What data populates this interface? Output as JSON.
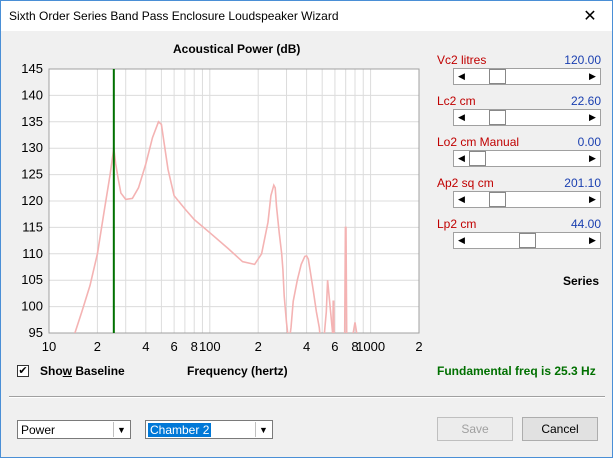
{
  "window": {
    "title": "Sixth Order Series Band Pass Enclosure Loudspeaker Wizard",
    "close_glyph": "✕"
  },
  "chart_title": "Acoustical Power (dB)",
  "chart_data": {
    "type": "line",
    "title": "Acoustical Power (dB)",
    "xlabel": "Frequency (hertz)",
    "ylabel": "",
    "x_scale": "log",
    "xlim": [
      10,
      2000
    ],
    "ylim": [
      95,
      145
    ],
    "yticks": [
      95,
      100,
      105,
      110,
      115,
      120,
      125,
      130,
      135,
      140,
      145
    ],
    "ytick_labels": [
      "95",
      "100",
      "105",
      "110",
      "115",
      "120",
      "125",
      "130",
      "135",
      "140",
      "145"
    ],
    "xticks": [
      10,
      20,
      40,
      60,
      80,
      100,
      200,
      400,
      600,
      800,
      1000,
      2000
    ],
    "xtick_labels": [
      "10",
      "2",
      "4",
      "6",
      "8",
      "100",
      "2",
      "4",
      "6",
      "8",
      "1000",
      "2"
    ],
    "grid": true,
    "marker_line": {
      "x": 25.3,
      "color": "#007000"
    },
    "series": [
      {
        "color": "#f4b3b3",
        "x": [
          14.5,
          16,
          18,
          20,
          22,
          24,
          25.3,
          26,
          27,
          28,
          30,
          33,
          36,
          40,
          44,
          48,
          50,
          52,
          55,
          60,
          70,
          80,
          100,
          130,
          160,
          190,
          210,
          230,
          240,
          250,
          255,
          260,
          270,
          280,
          285,
          290,
          300,
          310,
          320,
          330,
          350,
          370,
          390,
          400,
          410,
          420,
          440,
          460,
          480,
          490,
          500,
          510,
          520,
          530,
          540,
          560,
          580,
          600
        ],
        "values": [
          95,
          99,
          104,
          110,
          118,
          125,
          130,
          127,
          124,
          121.5,
          120.3,
          120.5,
          122.5,
          127,
          132,
          135,
          134.5,
          131,
          126,
          121,
          118.5,
          116.5,
          114,
          111,
          108.5,
          108,
          110,
          116,
          121,
          123,
          122.5,
          119,
          114,
          110,
          107,
          102,
          97,
          93,
          96,
          101,
          105,
          108,
          109.5,
          109.6,
          109,
          107,
          103,
          99,
          96,
          93,
          91,
          93,
          96,
          99,
          105,
          100,
          95,
          91
        ]
      },
      {
        "color": "#f4b3b3",
        "x": [
          580,
          585,
          590,
          595
        ],
        "values": [
          91,
          101,
          101,
          91
        ]
      },
      {
        "color": "#f4b3b3",
        "x": [
          690,
          697,
          700,
          703,
          710
        ],
        "values": [
          95,
          115,
          115,
          115,
          95
        ]
      },
      {
        "color": "#f4b3b3",
        "x": [
          780,
          800,
          820
        ],
        "values": [
          95,
          97,
          95
        ]
      }
    ]
  },
  "sliders": [
    {
      "label": "Vc2  litres",
      "value": "120.00",
      "level": 0.2
    },
    {
      "label": "Lc2  cm",
      "value": "22.60",
      "level": 0.2
    },
    {
      "label": "Lo2  cm  Manual",
      "value": "0.00",
      "level": 0.0
    },
    {
      "label": "Ap2  sq cm",
      "value": "201.10",
      "level": 0.2
    },
    {
      "label": "Lp2  cm",
      "value": "44.00",
      "level": 0.5
    }
  ],
  "series_label": "Series",
  "show_baseline": {
    "checked": "✔",
    "label_pre": "Sho",
    "label_ul": "w",
    "label_post": " Baseline"
  },
  "x_axis_label": "Frequency (hertz)",
  "fundamental": "Fundamental freq is 25.3 Hz",
  "bottom": {
    "mode_select": "Power",
    "chamber_select": "Chamber 2",
    "save_label": "Save",
    "cancel_label": "Cancel"
  }
}
